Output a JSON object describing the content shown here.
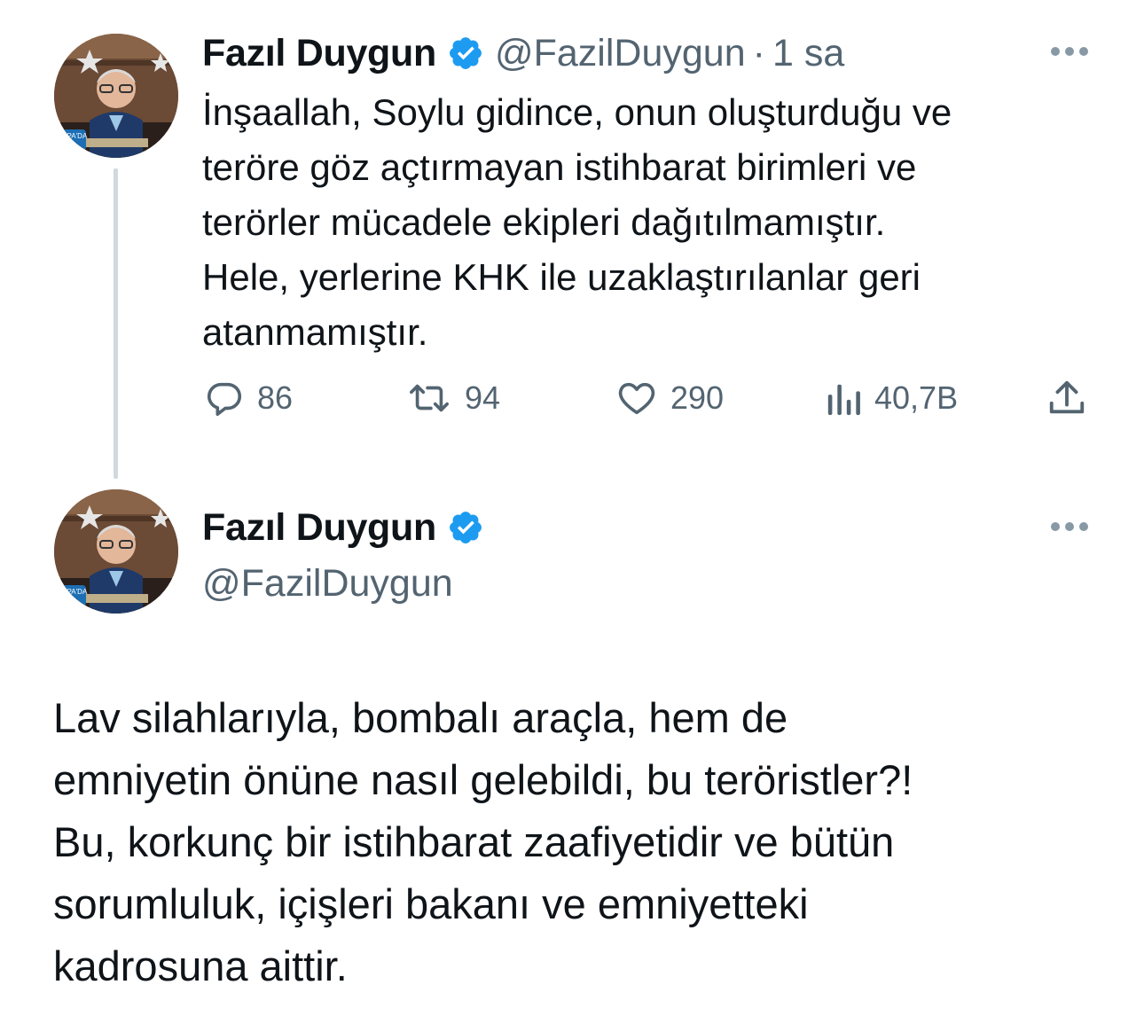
{
  "tweet1": {
    "author_name": "Fazıl Duygun",
    "handle": "@FazilDuygun",
    "dot": "·",
    "time": "1 sa",
    "text": "İnşaallah, Soylu gidince, onun oluşturduğu ve\nteröre göz açtırmayan istihbarat birimleri ve\nterörler mücadele ekipleri dağıtılmamıştır.\nHele, yerlerine KHK ile uzaklaştırılanlar geri\natanmamıştır.",
    "actions": {
      "replies": "86",
      "retweets": "94",
      "likes": "290",
      "views": "40,7B"
    },
    "icons": [
      "avatar-photo",
      "verified-badge-icon",
      "more-icon",
      "reply-icon",
      "retweet-icon",
      "like-icon",
      "views-icon",
      "share-icon"
    ]
  },
  "tweet2": {
    "author_name": "Fazıl Duygun",
    "handle": "@FazilDuygun",
    "text": "Lav silahlarıyla, bombalı araçla, hem de\nemniyetin önüne nasıl gelebildi, bu teröristler?!\nBu, korkunç bir istihbarat zaafiyetidir ve bütün\nsorumluluk, içişleri bakanı ve emniyetteki\nkadrosuna aittir.",
    "icons": [
      "avatar-photo",
      "verified-badge-icon",
      "more-icon"
    ]
  },
  "colors": {
    "text_primary": "#0f1419",
    "text_secondary": "#536471",
    "verified_blue": "#1d9bf0",
    "thread_line": "#cfd9de"
  }
}
